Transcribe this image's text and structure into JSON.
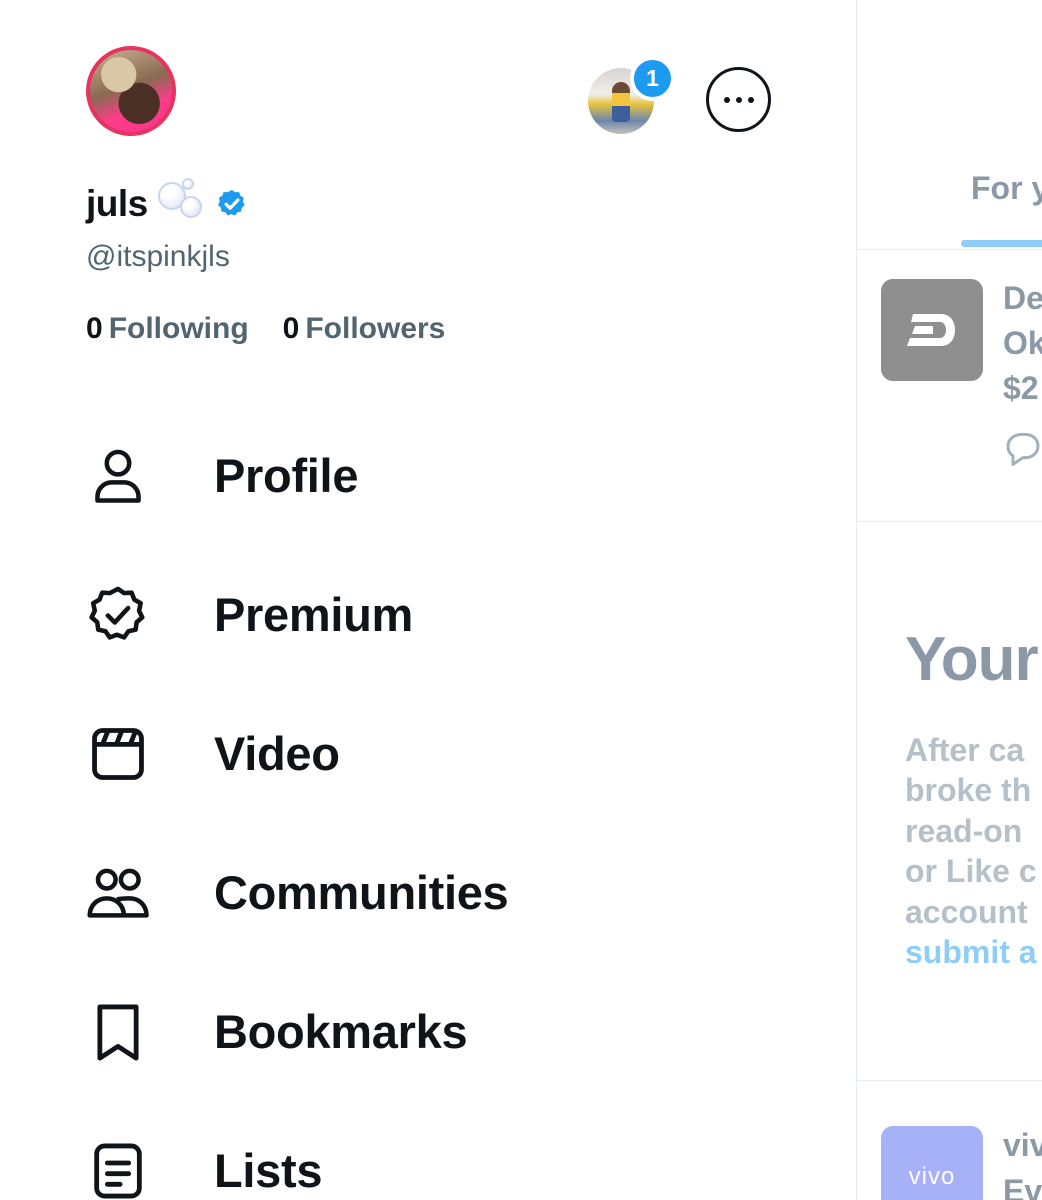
{
  "account": {
    "display_name": "juls",
    "handle": "@itspinkjls",
    "following_count": "0",
    "following_label": "Following",
    "followers_count": "0",
    "followers_label": "Followers",
    "switch_account_badge": "1"
  },
  "menu": [
    {
      "label": "Profile",
      "icon": "person-icon"
    },
    {
      "label": "Premium",
      "icon": "verified-badge-icon"
    },
    {
      "label": "Video",
      "icon": "video-icon"
    },
    {
      "label": "Communities",
      "icon": "communities-icon"
    },
    {
      "label": "Bookmarks",
      "icon": "bookmark-icon"
    },
    {
      "label": "Lists",
      "icon": "lists-icon"
    }
  ],
  "feed": {
    "tab_label": "For y",
    "ad_lines": "De\nOk\n$2",
    "notice_title": "Your",
    "notice_body": "After ca\nbroke th\nread-on\nor Like c\naccount",
    "notice_link": "submit a",
    "vivo_logo": "vivo",
    "vivo_lines": "viv\nEv"
  },
  "colors": {
    "accent": "#1d9bf0",
    "text_primary": "#0f1419",
    "text_secondary": "#536471",
    "avatar_ring": "#e8325f"
  }
}
